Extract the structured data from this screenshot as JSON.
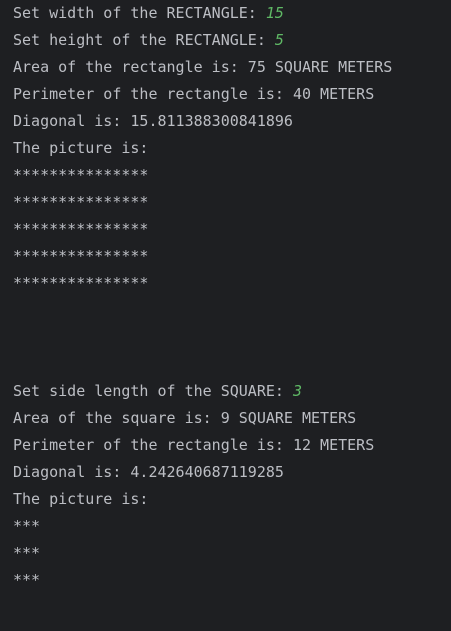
{
  "rectangle": {
    "width_prompt": "Set width of the RECTANGLE: ",
    "width_input": "15",
    "height_prompt": "Set height of the RECTANGLE: ",
    "height_input": "5",
    "area_line": "Area of the rectangle is: 75 SQUARE METERS",
    "perimeter_line": "Perimeter of the rectangle is: 40 METERS",
    "diagonal_line": "Diagonal is: 15.811388300841896",
    "picture_label": "The picture is:",
    "picture_rows": [
      "***************",
      "***************",
      "***************",
      "***************",
      "***************"
    ]
  },
  "square": {
    "side_prompt": "Set side length of the SQUARE: ",
    "side_input": "3",
    "area_line": "Area of the square is: 9 SQUARE METERS",
    "perimeter_line": "Perimeter of the rectangle is: 12 METERS",
    "diagonal_line": "Diagonal is: 4.242640687119285",
    "picture_label": "The picture is:",
    "picture_rows": [
      "***",
      "***",
      "***"
    ]
  },
  "colors": {
    "background": "#1e1f22",
    "text": "#bcbec4",
    "user_input": "#5fb865"
  }
}
